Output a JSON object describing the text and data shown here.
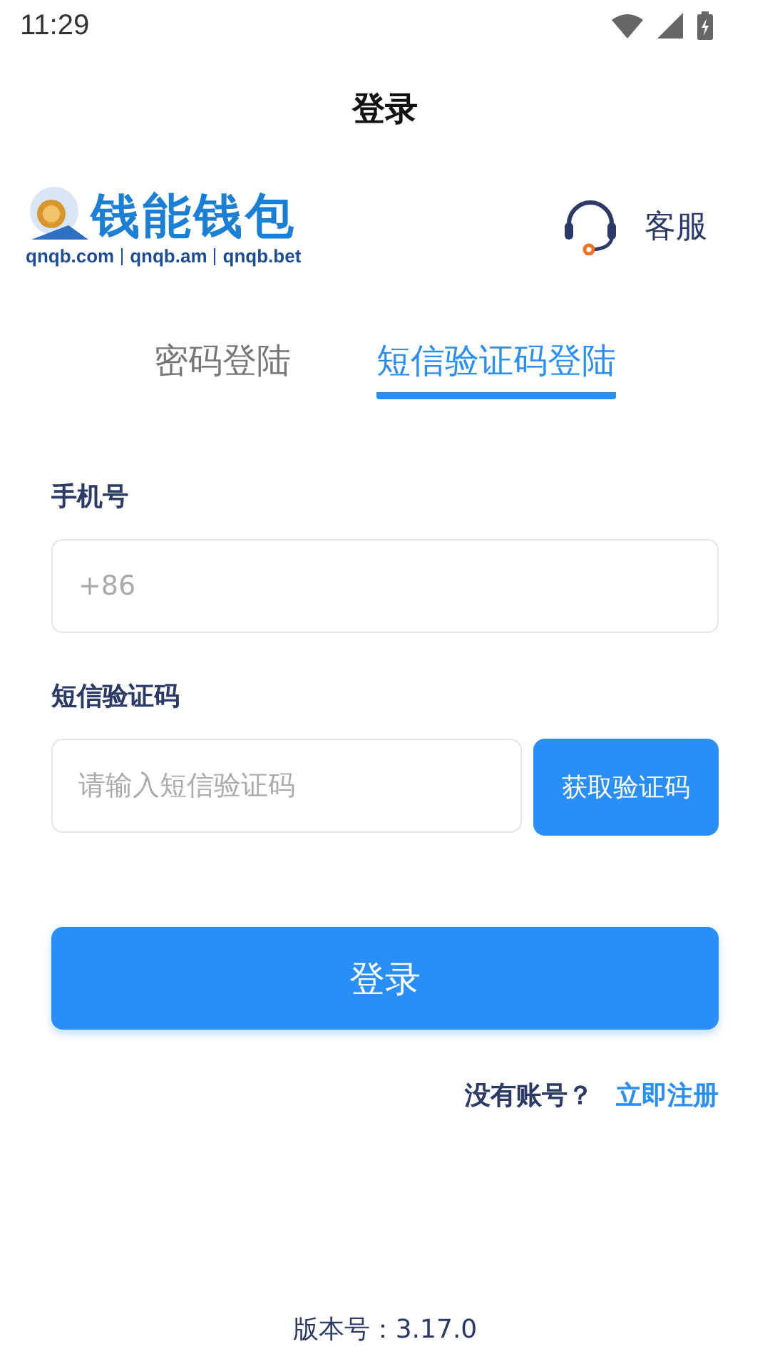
{
  "status_bar": {
    "time": "11:29"
  },
  "title": "登录",
  "logo": {
    "name": "钱能钱包",
    "domains": [
      "qnqb.com",
      "qnqb.am",
      "qnqb.bet"
    ]
  },
  "support": {
    "label": "客服"
  },
  "tabs": [
    {
      "label": "密码登陆",
      "selected": false
    },
    {
      "label": "短信验证码登陆",
      "selected": true
    }
  ],
  "phone": {
    "label": "手机号",
    "placeholder": "+86"
  },
  "code": {
    "label": "短信验证码",
    "placeholder": "请输入短信验证码",
    "button": "获取验证码"
  },
  "login_button": "登录",
  "register": {
    "prompt": "没有账号？",
    "link": "立即注册"
  },
  "version": "版本号：3.17.0"
}
